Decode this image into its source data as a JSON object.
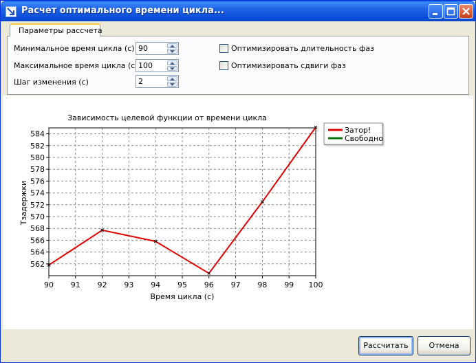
{
  "window": {
    "title": "Расчет оптимального времени цикла...",
    "accent": "#0a4cd6"
  },
  "icons": {
    "app": "arrow-down-right-icon",
    "minimize": "minimize-icon",
    "maximize": "maximize-icon",
    "close": "close-icon"
  },
  "tabs": [
    {
      "label": "Параметры рассчета",
      "selected": true
    }
  ],
  "params": {
    "min_cycle": {
      "label": "Минимальное время цикла (с)",
      "value": "90"
    },
    "max_cycle": {
      "label": "Максимальное время цикла (с)",
      "value": "100"
    },
    "step": {
      "label": "Шаг изменения (с)",
      "value": "2"
    }
  },
  "options": {
    "optimize_phase_duration": {
      "label": "Оптимизировать длительность фаз",
      "checked": false
    },
    "optimize_phase_shifts": {
      "label": "Оптимизировать сдвиги фаз",
      "checked": false
    }
  },
  "chart_data": {
    "type": "line",
    "title": "Зависимость целевой функции от времени цикла",
    "xlabel": "Время цикла (с)",
    "ylabel": "Тзадержки",
    "xlim": [
      90,
      100
    ],
    "ylim": [
      560,
      585
    ],
    "x_ticks": [
      90,
      91,
      92,
      93,
      94,
      95,
      96,
      97,
      98,
      99,
      100
    ],
    "y_ticks": [
      562,
      564,
      566,
      568,
      570,
      572,
      574,
      576,
      578,
      580,
      582,
      584
    ],
    "grid": true,
    "legend_position": "right",
    "series": [
      {
        "name": "Затор!",
        "color": "#e00000",
        "x": [
          90,
          92,
          94,
          96,
          98,
          100
        ],
        "y": [
          561.8,
          567.7,
          565.8,
          560.4,
          572.5,
          585.1
        ]
      },
      {
        "name": "Свободно",
        "color": "#007a00",
        "x": [],
        "y": []
      }
    ]
  },
  "buttons": {
    "calculate": "Рассчитать",
    "cancel": "Отмена"
  }
}
